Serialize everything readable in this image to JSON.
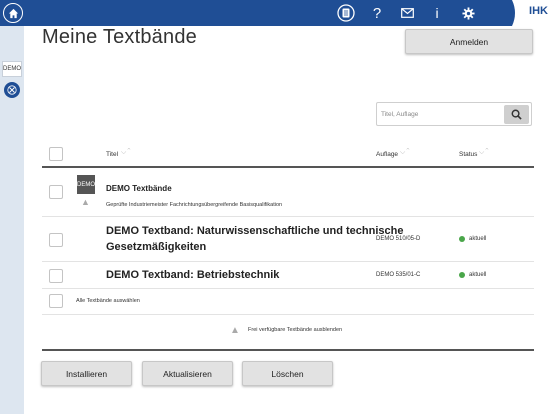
{
  "topbar": {
    "icons": [
      "home-icon",
      "book-icon",
      "help-icon",
      "mail-icon",
      "info-icon",
      "gear-icon"
    ],
    "help_glyph": "?",
    "info_glyph": "i",
    "logo": "IHK"
  },
  "sidebar": {
    "demo_label": "DEMO"
  },
  "page": {
    "title": "Meine Textbände"
  },
  "header": {
    "login_button": "Anmelden"
  },
  "search": {
    "placeholder": "Titel, Auflage"
  },
  "table": {
    "columns": {
      "title": "Titel",
      "edition": "Auflage",
      "status": "Status"
    },
    "group": {
      "tile_label": "DEMO",
      "title": "DEMO Textbände",
      "subtitle": "Geprüfte Industriemeister Fachrichtungsübergreifende Basisqualifikation"
    },
    "rows": [
      {
        "title_line1": "DEMO Textband: Naturwissenschaftliche und technische",
        "title_line2": "Gesetzmäßigkeiten",
        "edition": "DEMO 510/05-D",
        "status": "aktuell"
      },
      {
        "title_line1": "DEMO Textband: Betriebstechnik",
        "edition": "DEMO 535/01-C",
        "status": "aktuell"
      }
    ],
    "select_all": "Alle Textbände auswählen",
    "hide_free": "Frei verfügbare Textbände ausblenden"
  },
  "actions": {
    "install": "Installieren",
    "update": "Aktualisieren",
    "delete": "Löschen"
  },
  "colors": {
    "topbar": "#1f4e95",
    "sidebar": "#dde6f0",
    "status_ok": "#4aa64a"
  }
}
